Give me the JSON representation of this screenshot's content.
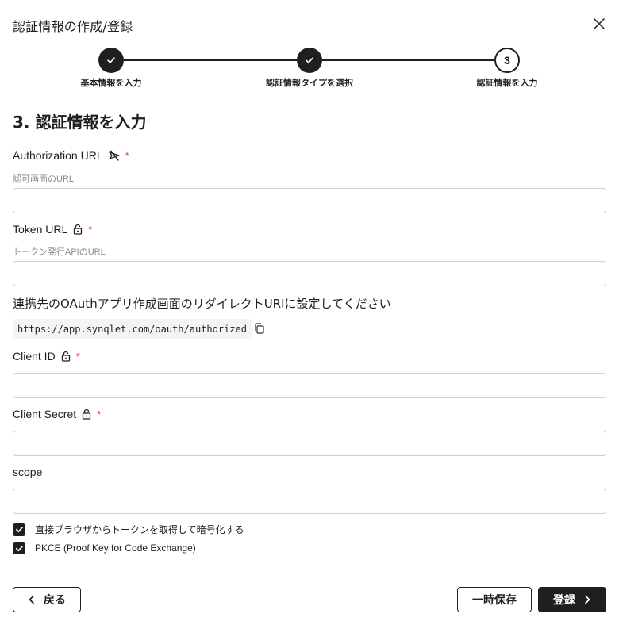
{
  "dialog": {
    "title": "認証情報の作成/登録"
  },
  "stepper": {
    "steps": [
      {
        "label": "基本情報を入力",
        "status": "done"
      },
      {
        "label": "認証情報タイプを選択",
        "status": "done"
      },
      {
        "label": "認証情報を入力",
        "status": "current",
        "number": "3"
      }
    ]
  },
  "section": {
    "title": "3. 認証情報を入力"
  },
  "fields": {
    "authorization_url": {
      "label": "Authorization URL",
      "hint": "認可画面のURL",
      "value": "",
      "required": "*",
      "icon": "eye-off-icon"
    },
    "token_url": {
      "label": "Token URL",
      "hint": "トークン発行APIのURL",
      "value": "",
      "required": "*",
      "icon": "lock-icon"
    },
    "client_id": {
      "label": "Client ID",
      "value": "",
      "required": "*",
      "icon": "lock-icon"
    },
    "client_secret": {
      "label": "Client Secret",
      "value": "",
      "required": "*",
      "icon": "lock-icon"
    },
    "scope": {
      "label": "scope",
      "value": ""
    }
  },
  "redirect": {
    "note": "連携先のOAuthアプリ作成画面のリダイレクトURIに設定してください",
    "url": "https://app.synqlet.com/oauth/authorized"
  },
  "options": [
    {
      "label": "直接ブラウザからトークンを取得して暗号化する",
      "checked": true
    },
    {
      "label": "PKCE (Proof Key for Code Exchange)",
      "checked": true
    }
  ],
  "buttons": {
    "back": "戻る",
    "save_draft": "一時保存",
    "register": "登録"
  },
  "colors": {
    "primary": "#1f1f1f",
    "required": "#e0392b"
  }
}
